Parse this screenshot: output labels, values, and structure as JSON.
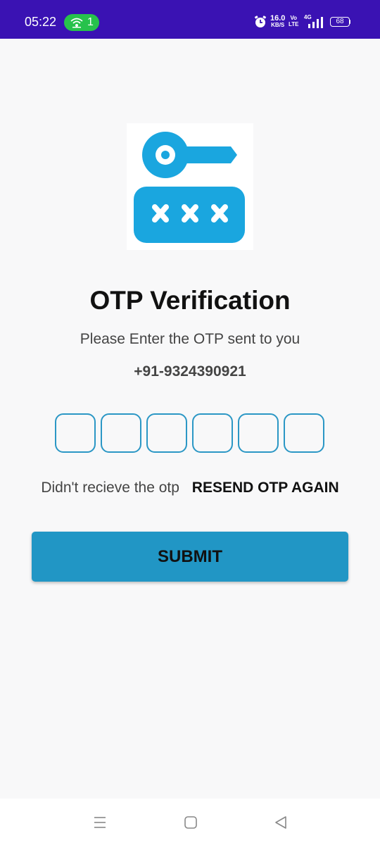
{
  "status_bar": {
    "time": "05:22",
    "hotspot_count": "1",
    "net_speed_value": "16.0",
    "net_speed_unit": "KB/S",
    "volte_top": "Vo",
    "volte_bottom": "LTE",
    "network_type": "4G",
    "battery": "68",
    "icons": [
      "hotspot-icon",
      "alarm-icon",
      "signal-icon",
      "battery-icon"
    ]
  },
  "logo": {
    "icon": "key-password-icon",
    "color": "#1aa6df"
  },
  "title": "OTP Verification",
  "subtitle": "Please Enter the OTP sent to you",
  "phone": "+91-9324390921",
  "otp": {
    "digits": [
      "",
      "",
      "",
      "",
      "",
      ""
    ],
    "border_color": "#2b97c5"
  },
  "resend": {
    "text": "Didn't recieve the otp",
    "link": "RESEND OTP AGAIN"
  },
  "submit": {
    "label": "SUBMIT",
    "color": "#2196c5"
  },
  "nav_bar": {
    "icons": [
      "recents-icon",
      "home-icon",
      "back-icon"
    ]
  }
}
